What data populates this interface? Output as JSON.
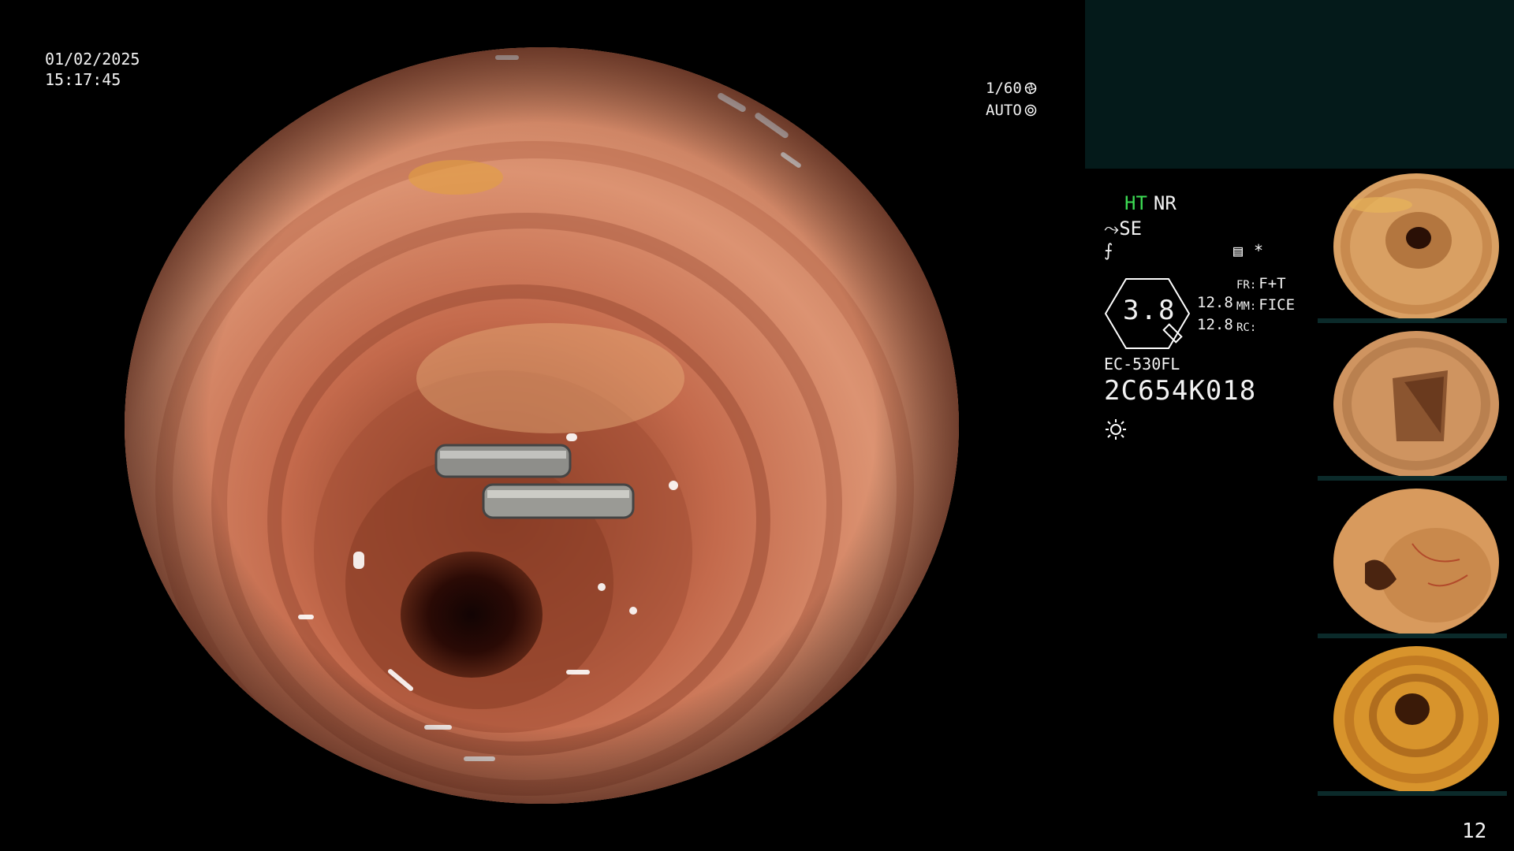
{
  "datetime": {
    "date": "01/02/2025",
    "time": "15:17:45"
  },
  "exposure": {
    "shutter": "1/60",
    "mode": "AUTO",
    "shutter_icon": "aperture-icon",
    "mode_icon": "auto-exposure-icon"
  },
  "settings": {
    "ht": "HT",
    "nr": "NR",
    "se": "SE",
    "se_icon": "structure-enhancement-icon",
    "contrast_icon": "contrast-curve-icon",
    "record_icon": "record-icon",
    "asterisk": "*",
    "magnification": "3.8",
    "value1": "12.8",
    "value2": "12.8",
    "fr_key": "FR:",
    "fr_val": "F+T",
    "mm_key": "MM:",
    "mm_val": "FICE",
    "rc_key": "RC:",
    "model": "EC-530FL",
    "serial": "2C654K018",
    "lamp_icon": "light-source-icon"
  },
  "thumbnails": [
    {
      "label": "thumbnail-1"
    },
    {
      "label": "thumbnail-2"
    },
    {
      "label": "thumbnail-3"
    },
    {
      "label": "thumbnail-4"
    }
  ],
  "page_number": "12",
  "colors": {
    "ht_green": "#3ddc54",
    "panel_teal": "#041a1a",
    "mucosa": "#c97b5b"
  }
}
